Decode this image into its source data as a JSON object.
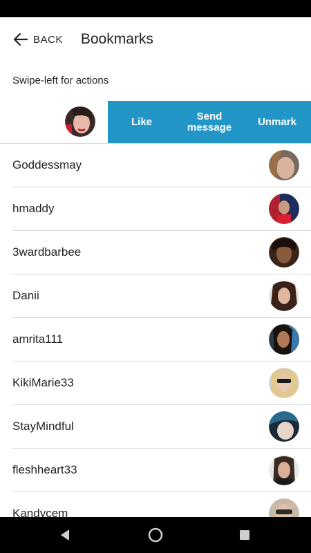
{
  "header": {
    "back_label": "BACK",
    "title": "Bookmarks",
    "back_icon": "arrow-left-icon"
  },
  "hint": "Swipe-left for actions",
  "swipe_actions": {
    "like_label": "Like",
    "send_message_label_1": "Send",
    "send_message_label_2": "message",
    "unmark_label": "Unmark",
    "accent_color": "#2196c7"
  },
  "bookmarks": [
    {
      "username": "Goddessmay"
    },
    {
      "username": "hmaddy"
    },
    {
      "username": "3wardbarbee"
    },
    {
      "username": "Danii"
    },
    {
      "username": "amrita111"
    },
    {
      "username": "KikiMarie33"
    },
    {
      "username": "StayMindful"
    },
    {
      "username": "fleshheart33"
    },
    {
      "username": "Kandycem"
    }
  ],
  "nav": {
    "back_icon": "triangle-back-icon",
    "home_icon": "circle-home-icon",
    "recents_icon": "square-recents-icon"
  }
}
